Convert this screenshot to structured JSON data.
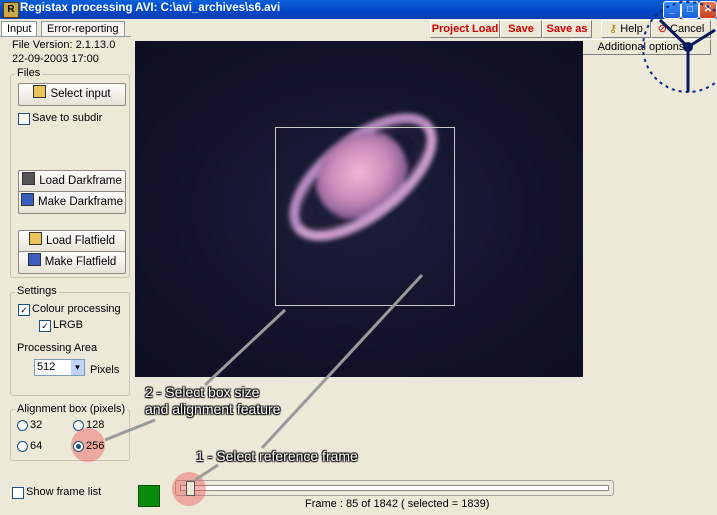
{
  "window": {
    "title": "Registax processing AVI: C:\\avi_archives\\s6.avi",
    "minimize": "_",
    "maximize": "□",
    "close": "✕"
  },
  "tabs": [
    {
      "label": "Input",
      "active": true
    },
    {
      "label": "Error-reporting",
      "active": false
    }
  ],
  "toolbar": {
    "project_load": "Project Load",
    "save": "Save",
    "save_as": "Save as",
    "help": "Help",
    "cancel": "Cancel",
    "additional_options": "Additional options"
  },
  "info": {
    "file_version": "File Version: 2.1.13.0",
    "date": "22-09-2003 17:00"
  },
  "files": {
    "legend": "Files",
    "select_input": "Select input",
    "save_to_subdir": "Save to subdir",
    "save_to_subdir_checked": false,
    "load_darkframe": "Load Darkframe",
    "make_darkframe": "Make Darkframe",
    "load_flatfield": "Load Flatfield",
    "make_flatfield": "Make Flatfield"
  },
  "settings": {
    "legend": "Settings",
    "colour_processing": "Colour processing",
    "colour_processing_checked": true,
    "lrgb": "LRGB",
    "lrgb_checked": true,
    "processing_area": "Processing Area",
    "area_value": "512",
    "pixels": "Pixels"
  },
  "alignment": {
    "legend": "Alignment box (pixels)",
    "options": [
      "32",
      "128",
      "64",
      "256"
    ],
    "selected": "256"
  },
  "show_frame_list": "Show frame list",
  "show_frame_list_checked": false,
  "frame_status": "Frame : 85 of 1842 ( selected = 1839)",
  "slider": {
    "position": 85,
    "max": 1842
  },
  "annotations": {
    "step2_line1": "2 - Select box size",
    "step2_line2": "and alignment feature",
    "step1": "1 - Select reference frame"
  },
  "colors": {
    "accent_red": "#d00000",
    "status_green": "#0c8a0c",
    "titlebar_blue": "#0046c7"
  }
}
